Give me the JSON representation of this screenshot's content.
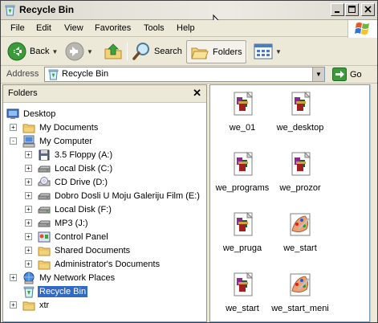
{
  "window": {
    "title": "Recycle Bin"
  },
  "menubar": {
    "items": [
      "File",
      "Edit",
      "View",
      "Favorites",
      "Tools",
      "Help"
    ]
  },
  "toolbar": {
    "back": "Back",
    "search": "Search",
    "folders": "Folders"
  },
  "address": {
    "label": "Address",
    "value": "Recycle Bin",
    "go": "Go"
  },
  "folders_pane": {
    "title": "Folders"
  },
  "tree": [
    {
      "label": "Desktop",
      "icon": "desktop-icon"
    },
    {
      "label": "My Documents",
      "icon": "folder-icon",
      "expander": "+"
    },
    {
      "label": "My Computer",
      "icon": "computer-icon",
      "expander": "-"
    },
    {
      "label": "3.5 Floppy (A:)",
      "icon": "floppy-icon",
      "expander": "+"
    },
    {
      "label": "Local Disk (C:)",
      "icon": "drive-icon",
      "expander": "+"
    },
    {
      "label": "CD Drive (D:)",
      "icon": "cd-drive-icon",
      "expander": "+"
    },
    {
      "label": "Dobro Dosli U Moju Galeriju Film (E:)",
      "icon": "drive-icon",
      "expander": "+"
    },
    {
      "label": "Local Disk (F:)",
      "icon": "drive-icon",
      "expander": "+"
    },
    {
      "label": "MP3 (J:)",
      "icon": "drive-icon",
      "expander": "+"
    },
    {
      "label": "Control Panel",
      "icon": "control-panel-icon",
      "expander": "+"
    },
    {
      "label": "Shared Documents",
      "icon": "folder-icon",
      "expander": "+"
    },
    {
      "label": "Administrator's Documents",
      "icon": "folder-icon",
      "expander": "+"
    },
    {
      "label": "My Network Places",
      "icon": "network-icon",
      "expander": "+"
    },
    {
      "label": "Recycle Bin",
      "icon": "recycle-bin-icon",
      "selected": true
    },
    {
      "label": "xtr",
      "icon": "folder-icon",
      "expander": "+"
    }
  ],
  "files": [
    {
      "label": "we_01",
      "icon": "winrar-archive-icon"
    },
    {
      "label": "we_desktop",
      "icon": "winrar-archive-icon"
    },
    {
      "label": "we_programs",
      "icon": "winrar-archive-icon"
    },
    {
      "label": "we_prozor",
      "icon": "winrar-archive-icon"
    },
    {
      "label": "we_pruga",
      "icon": "winrar-archive-icon"
    },
    {
      "label": "we_start",
      "icon": "paint-icon"
    },
    {
      "label": "we_start",
      "icon": "winrar-archive-icon"
    },
    {
      "label": "we_start_meni",
      "icon": "paint-icon"
    }
  ]
}
